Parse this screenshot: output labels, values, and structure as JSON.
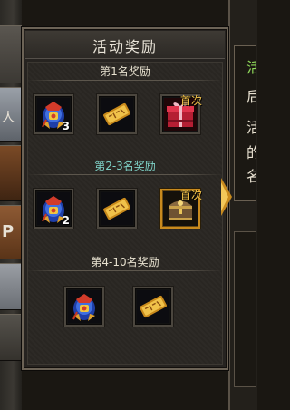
{
  "popup": {
    "title": "活动奖励",
    "sections": [
      {
        "label": "第1名奖励",
        "label_color": "#e8e2d0",
        "items": [
          {
            "icon": "armor-bag-icon",
            "count": "3",
            "tag": ""
          },
          {
            "icon": "gold-scroll-icon",
            "count": "",
            "tag": ""
          },
          {
            "icon": "red-gift-box-icon",
            "count": "",
            "tag": "首次"
          }
        ]
      },
      {
        "label": "第2-3名奖励",
        "label_color": "#7fd3c8",
        "items": [
          {
            "icon": "armor-bag-icon",
            "count": "2",
            "tag": ""
          },
          {
            "icon": "gold-scroll-icon",
            "count": "",
            "tag": ""
          },
          {
            "icon": "treasure-chest-icon",
            "count": "",
            "tag": "首次"
          }
        ]
      },
      {
        "label": "第4-10名奖励",
        "label_color": "#e8e2d0",
        "items": [
          {
            "icon": "armor-bag-icon",
            "count": "",
            "tag": ""
          },
          {
            "icon": "gold-scroll-icon",
            "count": "",
            "tag": ""
          }
        ]
      }
    ]
  },
  "right_panel": {
    "lines": [
      {
        "text": "活",
        "color": "green"
      },
      {
        "text": "后",
        "color": "white"
      },
      {
        "text": "活",
        "color": "white"
      },
      {
        "text": "的",
        "color": "white"
      },
      {
        "text": "名",
        "color": "white"
      }
    ]
  },
  "left_strip": {
    "glyphs": [
      "人",
      "P"
    ]
  },
  "colors": {
    "accent_gold": "#c88a1e",
    "tag_gold": "#f2c24a",
    "section_teal": "#7fd3c8"
  }
}
